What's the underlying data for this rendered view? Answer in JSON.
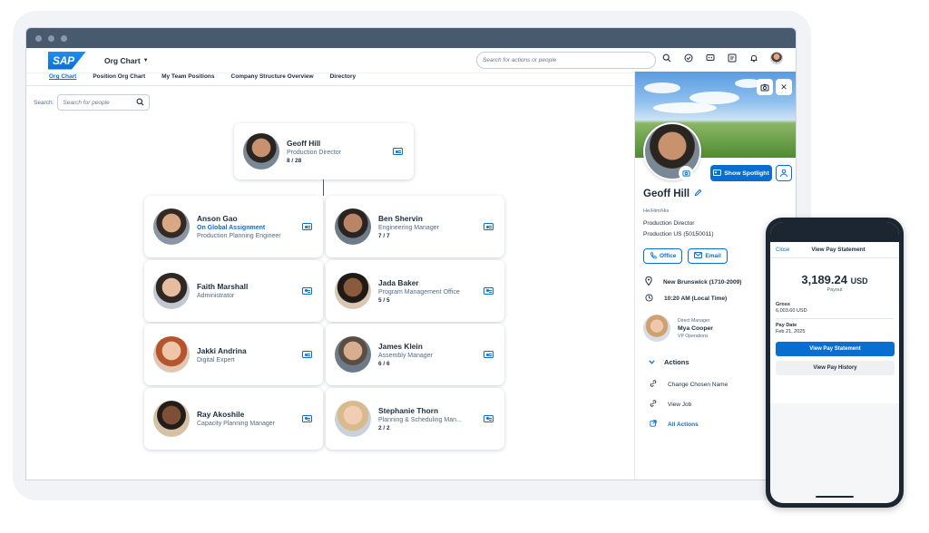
{
  "shell": {
    "logo": "SAP",
    "app_title": "Org Chart",
    "search_placeholder": "Search for actions or people"
  },
  "tabs": [
    "Org Chart",
    "Position Org Chart",
    "My Team Positions",
    "Company Structure Overview",
    "Directory"
  ],
  "search": {
    "label": "Search:",
    "placeholder": "Search for people"
  },
  "root": {
    "name": "Geoff Hill",
    "title": "Production Director",
    "count": "8 / 28"
  },
  "reports": [
    {
      "name": "Anson Gao",
      "status": "On Global Assignment",
      "title": "Production Planning Engineer",
      "count": ""
    },
    {
      "name": "Ben Shervin",
      "status": "",
      "title": "Engineering Manager",
      "count": "7 / 7"
    },
    {
      "name": "Faith Marshall",
      "status": "",
      "title": "Administrator",
      "count": ""
    },
    {
      "name": "Jada Baker",
      "status": "",
      "title": "Program Management Office",
      "count": "5 / 5"
    },
    {
      "name": "Jakki Andrina",
      "status": "",
      "title": "Digital Expert",
      "count": ""
    },
    {
      "name": "James Klein",
      "status": "",
      "title": "Assembly Manager",
      "count": "6 / 6"
    },
    {
      "name": "Ray Akoshile",
      "status": "",
      "title": "Capacity Planning Manager",
      "count": ""
    },
    {
      "name": "Stephanie Thorn",
      "status": "",
      "title": "Planning & Scheduling Man...",
      "count": "2 / 2"
    }
  ],
  "profile": {
    "name": "Geoff Hill",
    "pronouns": "He/Him/His",
    "title": "Production Director",
    "department": "Production US (50150011)",
    "spotlight_label": "Show Spotlight",
    "office_label": "Office",
    "email_label": "Email",
    "location": "New Brunswick (1710-2009)",
    "local_time": "10:20 AM (Local Time)",
    "manager_label": "Direct Manager",
    "manager_name": "Mya Cooper",
    "manager_title": "VP Operations",
    "actions_label": "Actions",
    "actions": [
      "Change Chosen Name",
      "View Job"
    ],
    "all_actions": "All Actions"
  },
  "phone": {
    "close_label": "Close",
    "title": "View Pay Statement",
    "amount": "3,189.24",
    "currency": "USD",
    "amount_caption": "Payout",
    "gross_label": "Gross",
    "gross_value": "6,003.60 USD",
    "paydate_label": "Pay Date",
    "paydate_value": "Feb 21, 2025",
    "primary_button": "View Pay Statement",
    "secondary_button": "View Pay History"
  },
  "colors": {
    "brand": "#0a6ed1",
    "titlebar": "#475a6e",
    "text": "#1d2d3e"
  }
}
